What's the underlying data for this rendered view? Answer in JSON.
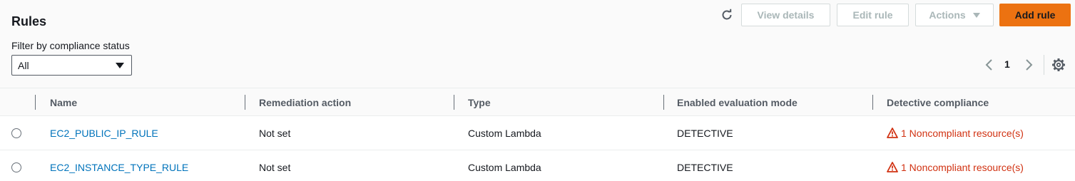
{
  "header": {
    "title": "Rules",
    "filter_label": "Filter by compliance status",
    "filter_value": "All"
  },
  "toolbar": {
    "view_details": "View details",
    "edit_rule": "Edit rule",
    "actions": "Actions",
    "add_rule": "Add rule"
  },
  "pagination": {
    "page": "1"
  },
  "table": {
    "columns": [
      "Name",
      "Remediation action",
      "Type",
      "Enabled evaluation mode",
      "Detective compliance"
    ],
    "rows": [
      {
        "name": "EC2_PUBLIC_IP_RULE",
        "remediation": "Not set",
        "type": "Custom Lambda",
        "mode": "DETECTIVE",
        "compliance": "1 Noncompliant resource(s)"
      },
      {
        "name": "EC2_INSTANCE_TYPE_RULE",
        "remediation": "Not set",
        "type": "Custom Lambda",
        "mode": "DETECTIVE",
        "compliance": "1 Noncompliant resource(s)"
      }
    ]
  },
  "colors": {
    "primary_button": "#ec7211",
    "link": "#0073bb",
    "error": "#d13212"
  }
}
